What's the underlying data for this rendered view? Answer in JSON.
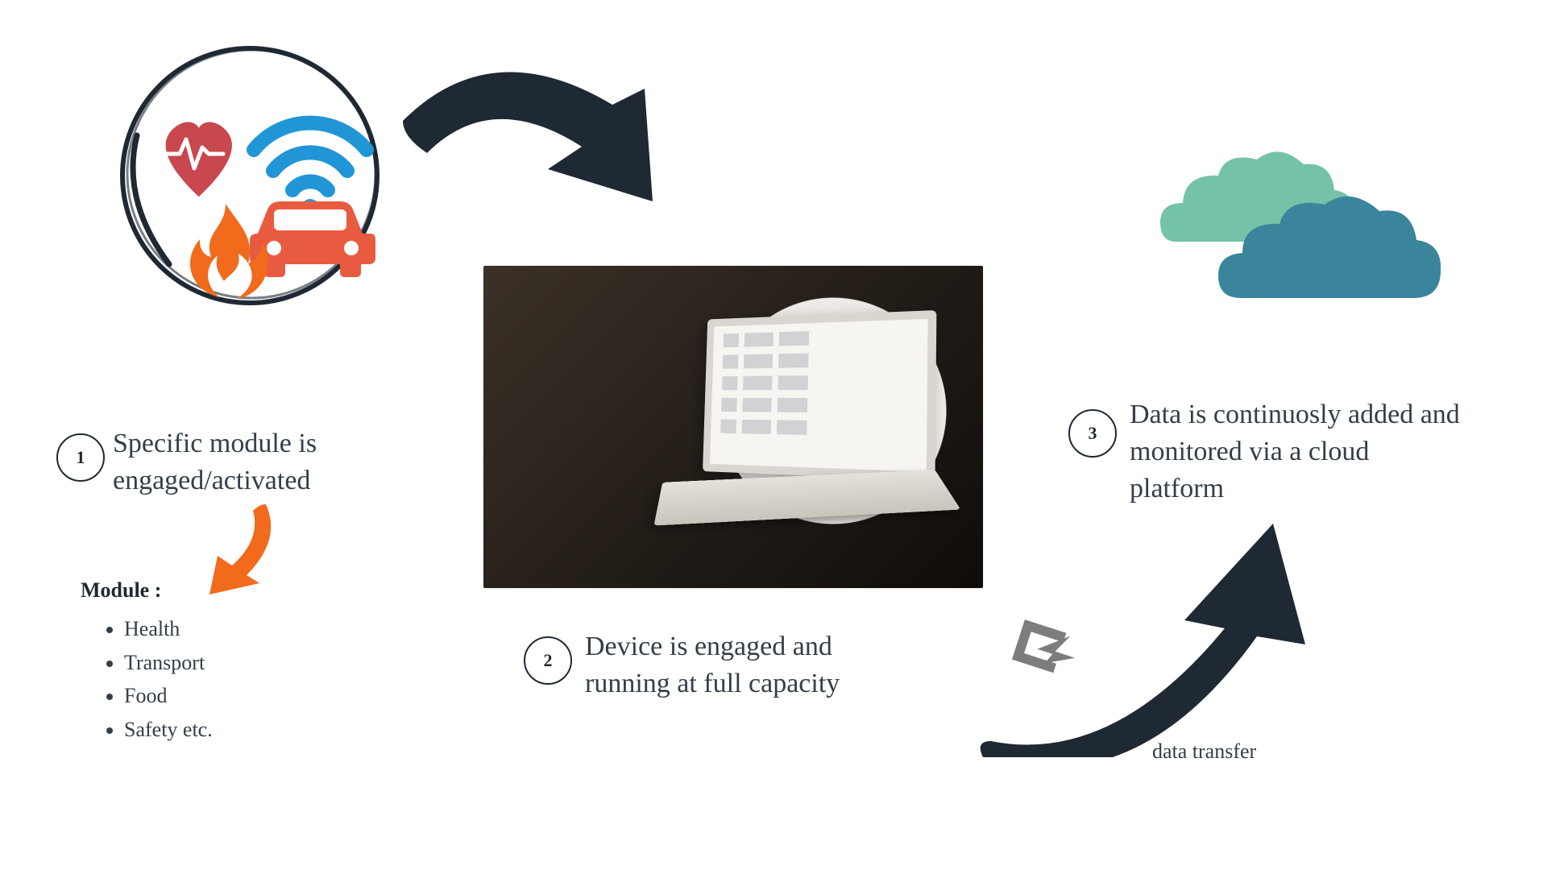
{
  "steps": [
    {
      "num": "1",
      "text": "Specific module is engaged/activated"
    },
    {
      "num": "2",
      "text": "Device is engaged and running at full capacity"
    },
    {
      "num": "3",
      "text": "Data is continuosly added and monitored via a cloud platform"
    }
  ],
  "module": {
    "label": "Module :",
    "items": [
      "Health",
      "Transport",
      "Food",
      "Safety etc."
    ]
  },
  "captions": {
    "data_transfer": "data transfer"
  },
  "colors": {
    "dark": "#1f2933",
    "orange": "#f26a1b",
    "red": "#c9474e",
    "blue": "#2196d6",
    "grey": "#7d7d7d",
    "cloud_light": "#74c2a7",
    "cloud_dark": "#3b859c"
  }
}
